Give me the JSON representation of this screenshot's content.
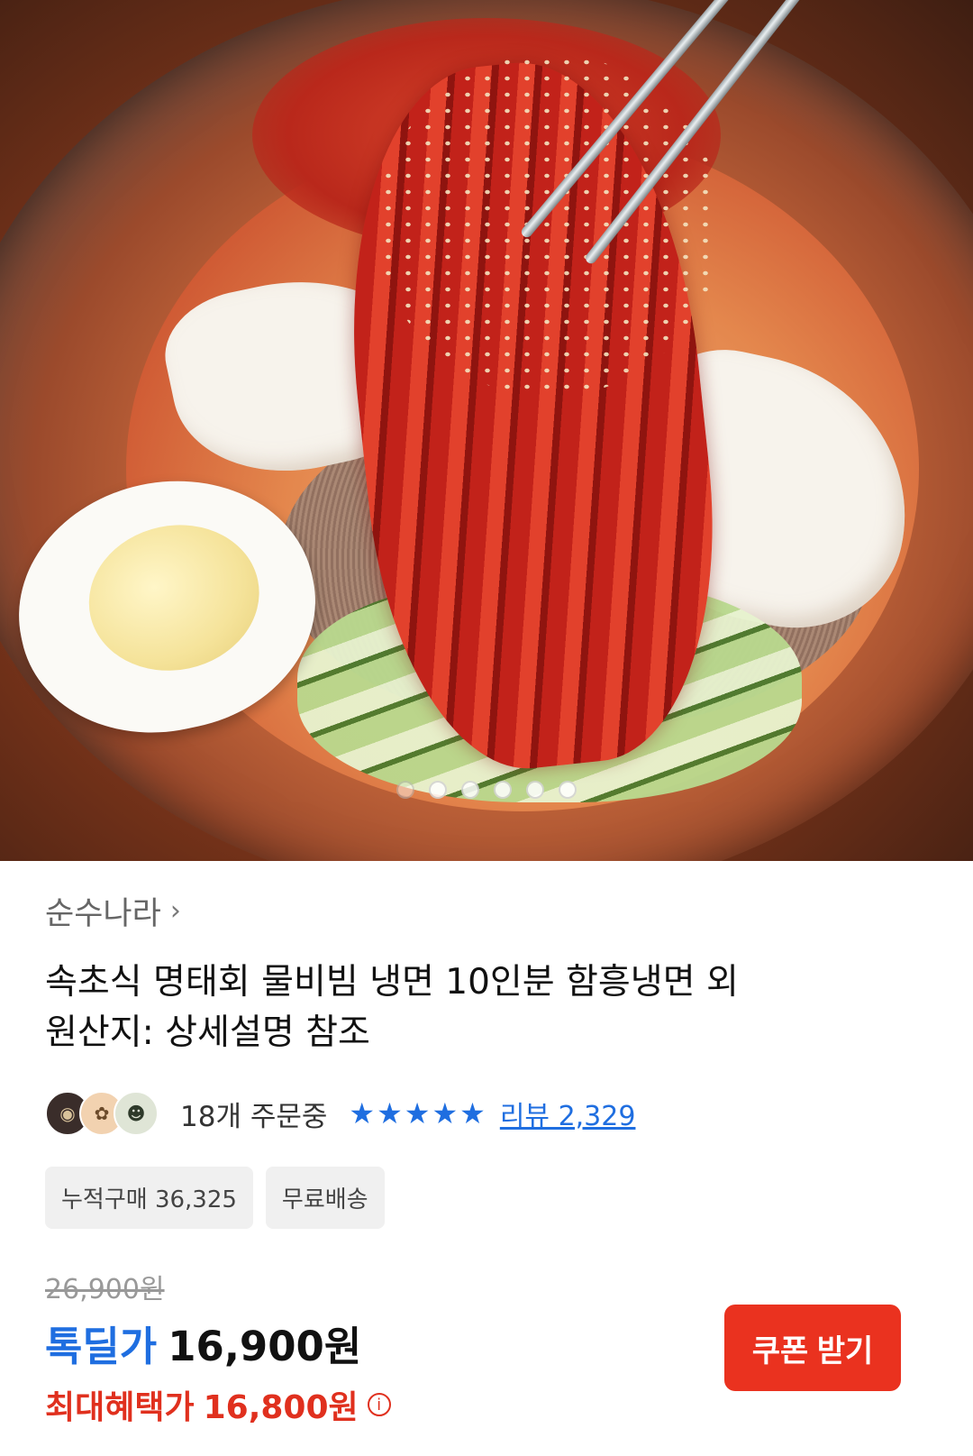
{
  "hero": {
    "image_label": "",
    "carousel_total": 6,
    "carousel_active": 1
  },
  "product": {
    "seller": "순수나라",
    "seller_chevron": "›",
    "title_line1": "속초식 명태회 물비빔 냉면 10인분 함흥냉면 외",
    "title_line2": "원산지: 상세설명 참조",
    "order_status": "18개 주문중",
    "rating_stars": "★★★★★",
    "reviews": "리뷰 2,329",
    "tags": [
      "누적구매 36,325",
      "무료배송"
    ],
    "original_price": "26,900원",
    "deal_label": "톡딜가",
    "deal_price": "16,900원",
    "benefit_label": "최대혜택가",
    "benefit_price": "16,800원",
    "info_icon": "i",
    "coupon_button": "쿠폰 받기"
  },
  "colors": {
    "accent_blue": "#1f6ee0",
    "accent_red": "#e0301e",
    "button_red": "#ea321f"
  }
}
